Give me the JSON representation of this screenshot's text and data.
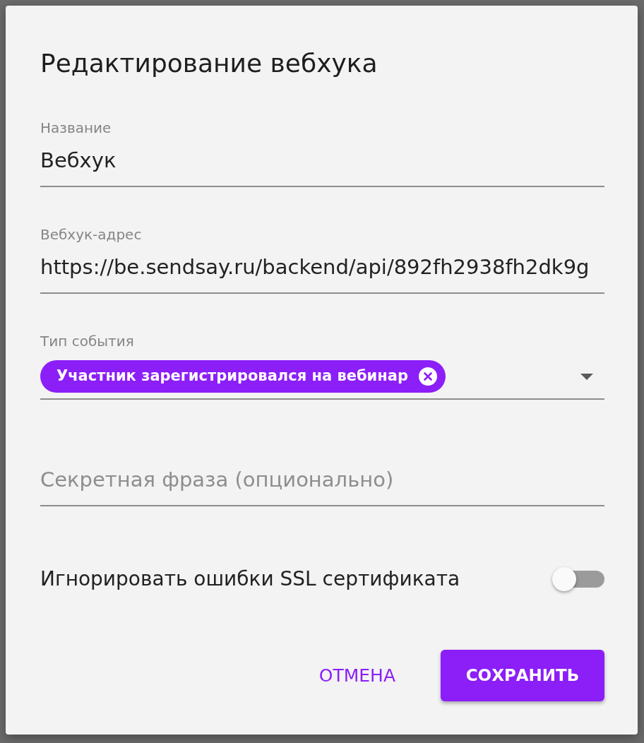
{
  "dialog": {
    "title": "Редактирование вебхука"
  },
  "fields": [
    {
      "kind": "text",
      "label": "Название",
      "value": "Вебхук"
    },
    {
      "kind": "text",
      "label": "Вебхук-адрес",
      "value": "https://be.sendsay.ru/backend/api/892fh2938fh2dk9g"
    },
    {
      "kind": "select",
      "label": "Тип события",
      "chips": [
        {
          "label": "Участник зарегистрировался на вебинар"
        }
      ]
    },
    {
      "kind": "text",
      "placeholder": "Секретная фраза (опционально)"
    }
  ],
  "switch": {
    "label": "Игнорировать ошибки SSL сертификата",
    "on": false
  },
  "buttons": [
    {
      "kind": "text",
      "label": "ОТМЕНА"
    },
    {
      "kind": "contained",
      "label": "СОХРАНИТЬ"
    }
  ]
}
